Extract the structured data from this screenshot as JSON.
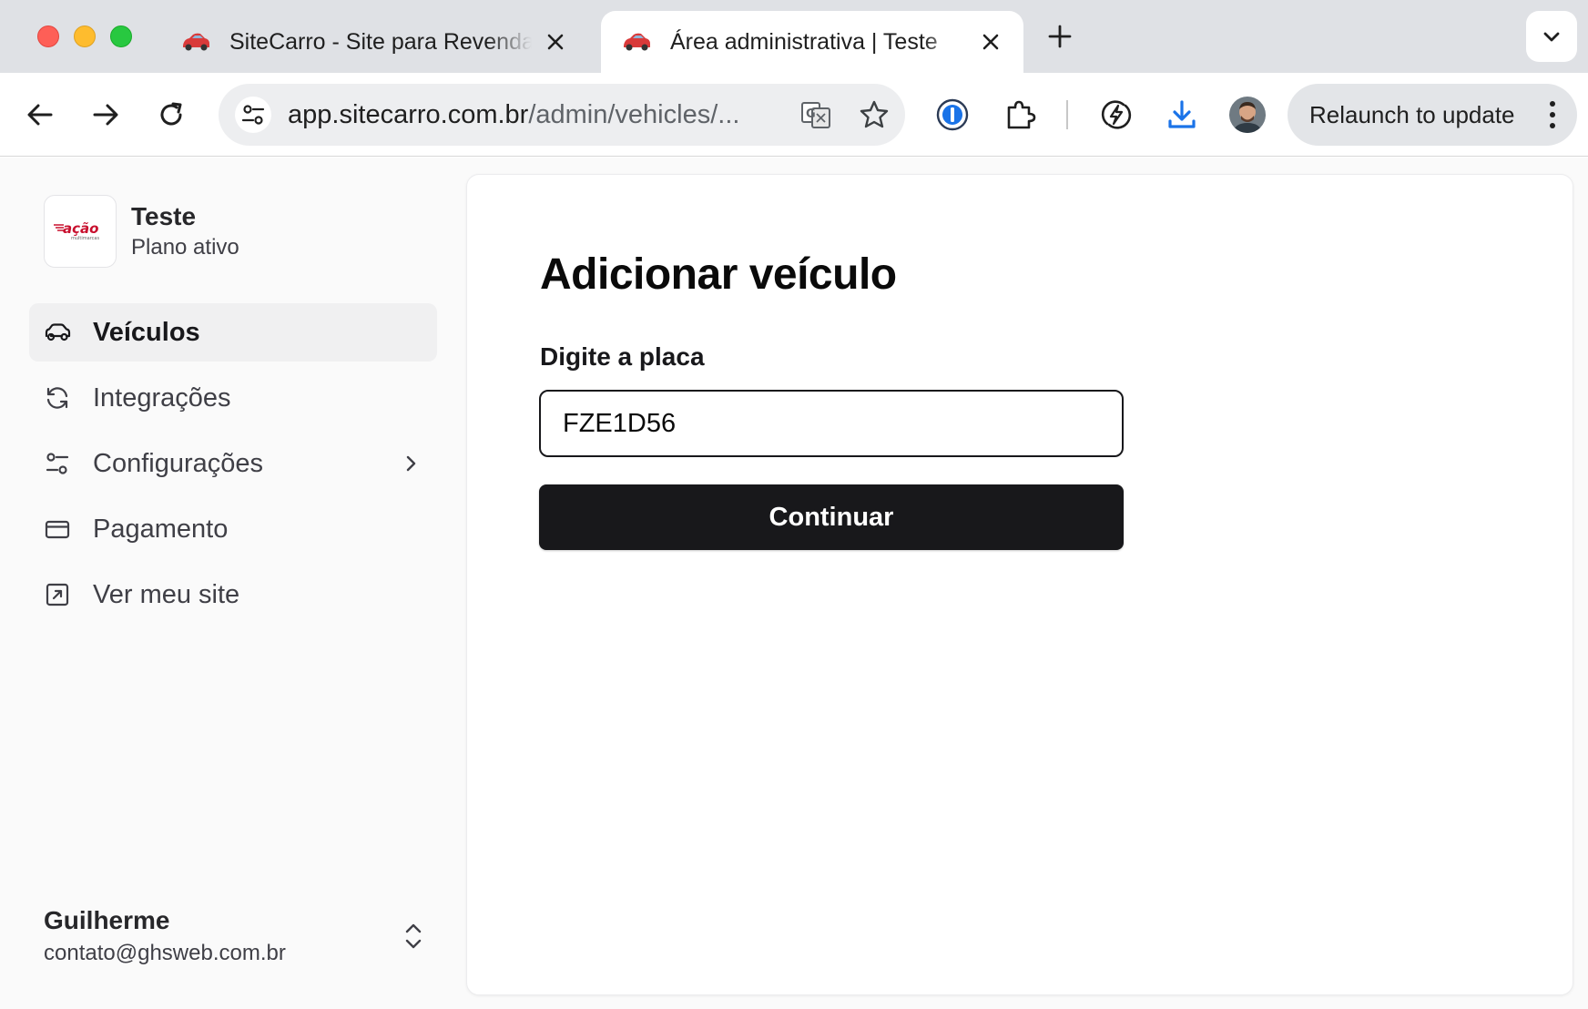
{
  "browser": {
    "tabs": [
      {
        "title": "SiteCarro - Site para Revenda",
        "active": false
      },
      {
        "title": "Área administrativa | Teste",
        "active": true
      }
    ],
    "url_host": "app.sitecarro.com.br",
    "url_path": "/admin/vehicles/...",
    "relaunch_label": "Relaunch to update",
    "colors": {
      "tabstrip": "#dfe1e5",
      "omnibox": "#edeef0",
      "download_accent": "#1a73e8"
    }
  },
  "sidebar": {
    "org_name": "Teste",
    "org_plan": "Plano ativo",
    "logo_text": "ação",
    "logo_subtext": "multimarcas",
    "nav": [
      {
        "label": "Veículos",
        "icon": "car-icon",
        "active": true
      },
      {
        "label": "Integrações",
        "icon": "refresh-icon",
        "active": false
      },
      {
        "label": "Configurações",
        "icon": "sliders-icon",
        "active": false,
        "has_submenu": true
      },
      {
        "label": "Pagamento",
        "icon": "credit-card-icon",
        "active": false
      },
      {
        "label": "Ver meu site",
        "icon": "external-link-icon",
        "active": false
      }
    ],
    "user_name": "Guilherme",
    "user_email": "contato@ghsweb.com.br"
  },
  "main": {
    "title": "Adicionar veículo",
    "plate_label": "Digite a placa",
    "plate_value": "FZE1D56",
    "continue_label": "Continuar"
  }
}
